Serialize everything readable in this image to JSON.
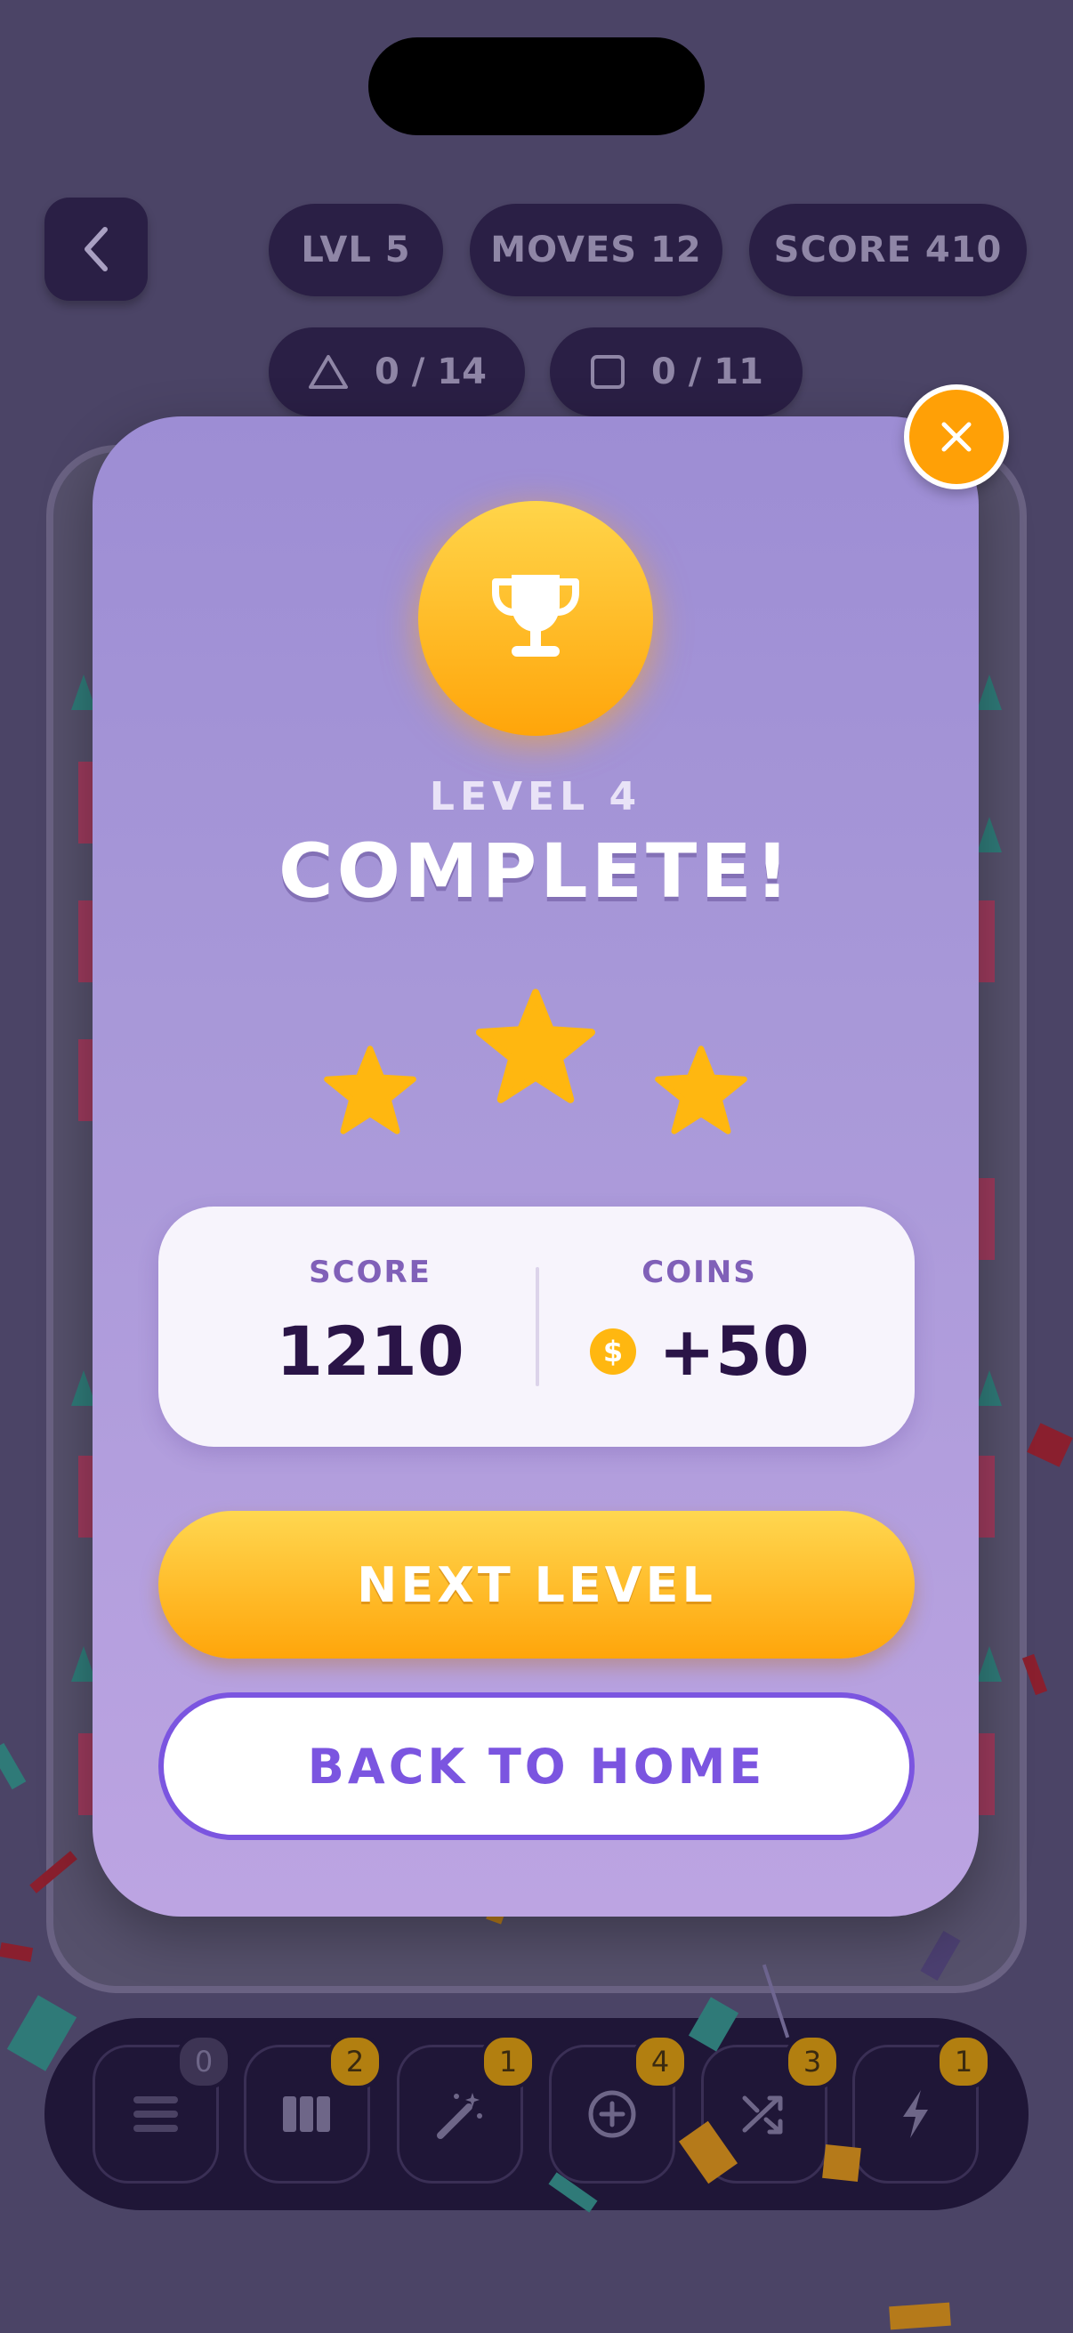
{
  "hud": {
    "level": "LVL 5",
    "moves": "MOVES 12",
    "score": "SCORE 410",
    "goals": [
      {
        "icon": "triangle-icon",
        "text": "0 / 14"
      },
      {
        "icon": "square-icon",
        "text": "0 / 11"
      }
    ]
  },
  "modal": {
    "level_label": "LEVEL 4",
    "title": "COMPLETE!",
    "stars_earned": 3,
    "stars_total": 3,
    "score_label": "SCORE",
    "score_value": "1210",
    "coins_label": "COINS",
    "coins_value": "+50",
    "next_button": "NEXT LEVEL",
    "home_button": "BACK TO HOME"
  },
  "toolbar": {
    "tools": [
      {
        "icon": "menu-icon",
        "count": "0"
      },
      {
        "icon": "columns-icon",
        "count": "2"
      },
      {
        "icon": "magic-wand-icon",
        "count": "1"
      },
      {
        "icon": "plus-circle-icon",
        "count": "4"
      },
      {
        "icon": "shuffle-icon",
        "count": "3"
      },
      {
        "icon": "lightning-icon",
        "count": "1"
      }
    ]
  },
  "colors": {
    "background": "#4b4466",
    "accent_orange": "#ffa50a",
    "accent_purple": "#7b55e0",
    "dark_text": "#2a1447"
  }
}
